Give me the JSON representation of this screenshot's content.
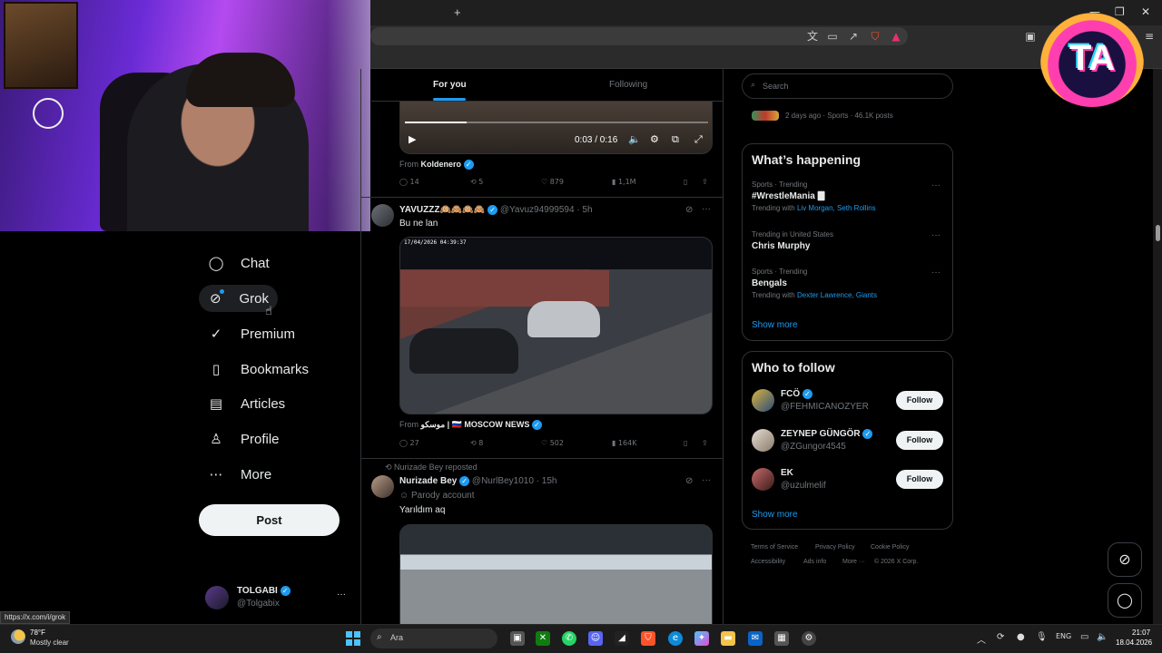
{
  "browser": {
    "new_tab_icon": "+",
    "window_controls": [
      "—",
      "❐",
      "✕"
    ]
  },
  "nav": {
    "items": [
      {
        "label": "Chat",
        "icon": "chat-icon",
        "glyph": "◯"
      },
      {
        "label": "Grok",
        "icon": "grok-icon",
        "glyph": "⊘"
      },
      {
        "label": "Premium",
        "icon": "premium-icon",
        "glyph": "✓"
      },
      {
        "label": "Bookmarks",
        "icon": "bookmark-icon",
        "glyph": "▯"
      },
      {
        "label": "Articles",
        "icon": "articles-icon",
        "glyph": "▤"
      },
      {
        "label": "Profile",
        "icon": "profile-icon",
        "glyph": "♙"
      },
      {
        "label": "More",
        "icon": "more-icon",
        "glyph": "⋯"
      }
    ],
    "post_label": "Post",
    "account": {
      "name": "TOLGABI",
      "handle": "@Tolgabix",
      "more": "···"
    }
  },
  "timeline": {
    "tabs": {
      "for_you": "For you",
      "following": "Following"
    },
    "tweet1": {
      "time": "0:03 / 0:16",
      "from_prefix": "From",
      "from_name": "Koldenero",
      "stats": {
        "replies": "14",
        "reposts": "5",
        "likes": "879",
        "views": "1,1M"
      }
    },
    "tweet2": {
      "name": "YAVUZZZ🙉🙈🙉🙈",
      "handle": "@Yavuz94999594",
      "age": "· 5h",
      "text": "Bu ne lan",
      "cctv_timestamp": "17/04/2026 04:39:37",
      "from_prefix": "From",
      "from_name": "موسکو | 🇷🇺 MOSCOW NEWS",
      "stats": {
        "replies": "27",
        "reposts": "8",
        "likes": "502",
        "views": "164K"
      }
    },
    "tweet3": {
      "repost_label": "Nurizade Bey reposted",
      "name": "Nurizade Bey",
      "handle": "@NurlBey1010",
      "age": "· 15h",
      "badge": "Parody account",
      "text": "Yarıldım aq"
    }
  },
  "sidebar": {
    "search_placeholder": "Search",
    "partial_trend_meta": "2 days ago · Sports · 46.1K posts",
    "whats_happening": "What’s happening",
    "trends": [
      {
        "category": "Sports · Trending",
        "name": "#WrestleMania 🀫",
        "with_prefix": "Trending with",
        "with": "Liv Morgan, Seth Rollins"
      },
      {
        "category": "Trending in United States",
        "name": "Chris Murphy",
        "with_prefix": "",
        "with": ""
      },
      {
        "category": "Sports · Trending",
        "name": "Bengals",
        "with_prefix": "Trending with",
        "with": "Dexter Lawrence, Giants"
      }
    ],
    "show_more": "Show more",
    "who_to_follow": "Who to follow",
    "follow_suggestions": [
      {
        "name": "FCÖ",
        "handle": "@FEHMICANOZYER",
        "button": "Follow"
      },
      {
        "name": "ZEYNEP GÜNGÖR",
        "handle": "@ZGungor4545",
        "button": "Follow"
      },
      {
        "name": "EK",
        "handle": "@uzulmelif",
        "button": "Follow"
      }
    ],
    "show_more_2": "Show more",
    "footer": [
      "Terms of Service",
      "Privacy Policy",
      "Cookie Policy",
      "Accessibility",
      "Ads info",
      "More ···",
      "© 2026 X Corp."
    ]
  },
  "overlay": {
    "logo_text": "TA"
  },
  "status_url": "https://x.com/i/grok",
  "taskbar": {
    "weather_temp": "78°F",
    "weather_desc": "Mostly clear",
    "search_placeholder": "Ara",
    "lang": "ENG",
    "time": "21:07",
    "date": "18.04.2026"
  }
}
